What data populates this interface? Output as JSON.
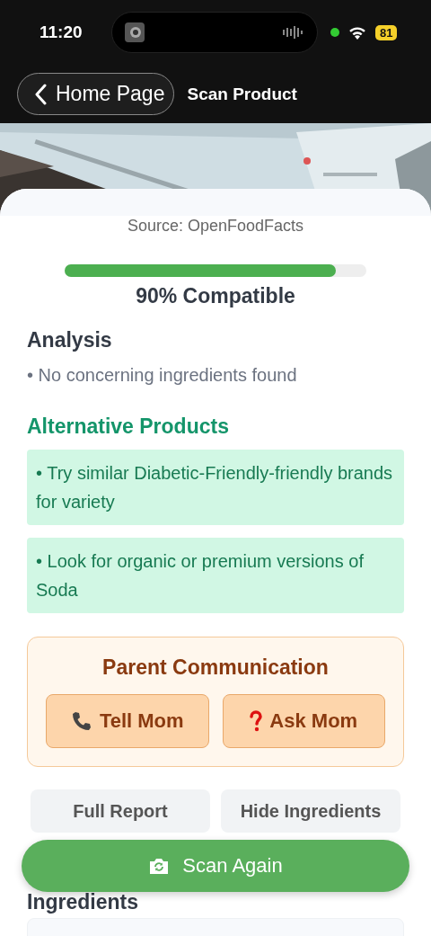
{
  "status_bar": {
    "time": "11:20",
    "battery": "81"
  },
  "nav": {
    "back_label": "Home Page",
    "title": "Scan Product"
  },
  "source": "Source: OpenFoodFacts",
  "compatibility": {
    "level": 0.9,
    "label": "90% Compatible"
  },
  "analysis": {
    "title": "Analysis",
    "items": [
      "• No concerning ingredients found"
    ]
  },
  "alternatives": {
    "title": "Alternative Products",
    "items": [
      "• Try similar Diabetic-Friendly-friendly brands for variety",
      "• Look for organic or premium versions of Soda"
    ]
  },
  "parent_communication": {
    "title": "Parent Communication",
    "buttons": [
      {
        "kind": "phone",
        "label": "Tell Mom"
      },
      {
        "kind": "question",
        "label": "Ask Mom"
      }
    ]
  },
  "actions": [
    "Full Report",
    "Hide Ingredients"
  ],
  "ingredients": {
    "title": "Ingredients"
  },
  "scan_button": {
    "label": "Scan Again"
  }
}
